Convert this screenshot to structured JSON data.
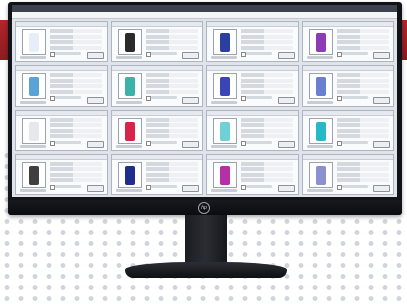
{
  "scene": {
    "colors": {
      "band": "#b3262c",
      "screen": "#dfe3ea",
      "bezel": "#111318",
      "dots": "#c9ccd3"
    },
    "logo_icon": "hp-logo-icon"
  },
  "app": {
    "title": "",
    "menu": []
  },
  "tiles": [
    {
      "fill": "#e8eef7"
    },
    {
      "fill": "#2b2b2b"
    },
    {
      "fill": "#2a3fa0"
    },
    {
      "fill": "#8a3bb5"
    },
    {
      "fill": "#5aa3d6"
    },
    {
      "fill": "#3bb3a8"
    },
    {
      "fill": "#3a46b8"
    },
    {
      "fill": "#6b7fd0"
    },
    {
      "fill": "#e6e8ee"
    },
    {
      "fill": "#d8234a"
    },
    {
      "fill": "#6fd0d6"
    },
    {
      "fill": "#28b9c9"
    },
    {
      "fill": "#3f3f3f"
    },
    {
      "fill": "#1e2e8a"
    },
    {
      "fill": "#b52fa6"
    },
    {
      "fill": "#8c8fd0"
    }
  ]
}
